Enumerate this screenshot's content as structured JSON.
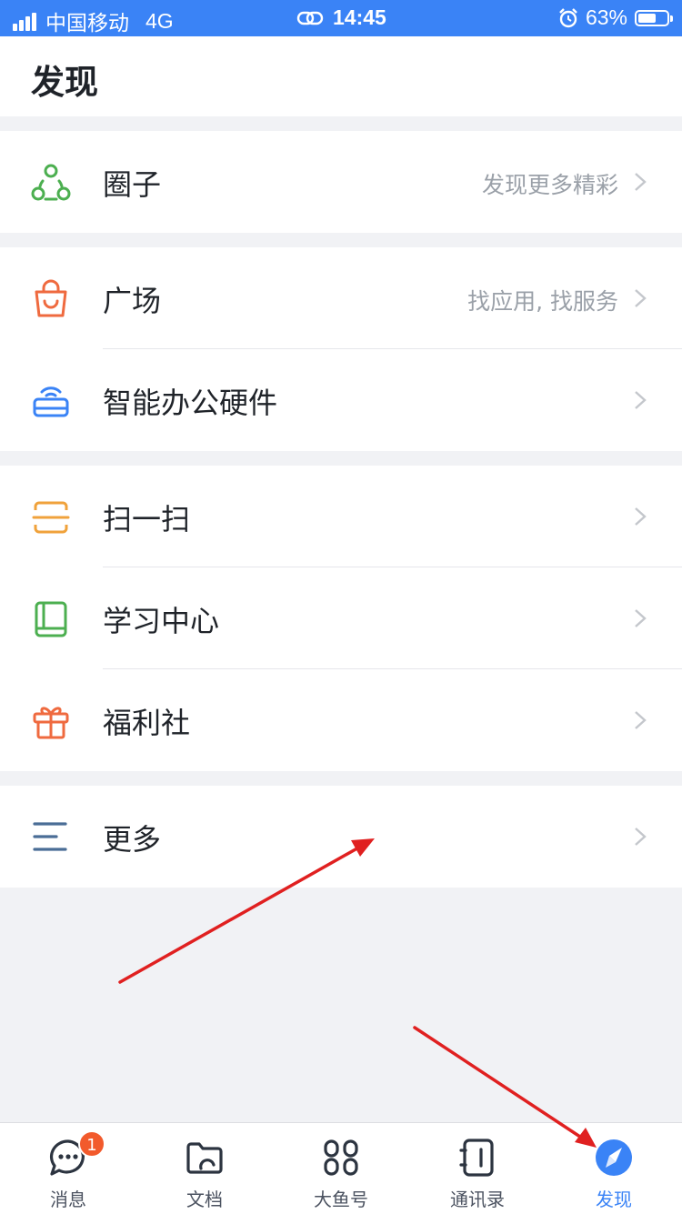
{
  "status_bar": {
    "carrier": "中国移动",
    "network": "4G",
    "time": "14:45",
    "battery_text": "63%",
    "battery_level": 0.63
  },
  "header": {
    "title": "发现"
  },
  "groups": [
    {
      "items": [
        {
          "label": "圈子",
          "subtitle": "发现更多精彩",
          "icon": "circle-group-icon",
          "color": "#4caf50"
        }
      ]
    },
    {
      "items": [
        {
          "label": "广场",
          "subtitle": "找应用, 找服务",
          "icon": "shopping-bag-icon",
          "color": "#ef6a3f"
        },
        {
          "label": "智能办公硬件",
          "subtitle": "",
          "icon": "hardware-device-icon",
          "color": "#3a83f6"
        }
      ]
    },
    {
      "items": [
        {
          "label": "扫一扫",
          "subtitle": "",
          "icon": "scan-icon",
          "color": "#f0a23b"
        },
        {
          "label": "学习中心",
          "subtitle": "",
          "icon": "book-icon",
          "color": "#4caf50"
        },
        {
          "label": "福利社",
          "subtitle": "",
          "icon": "gift-icon",
          "color": "#ef6a3f"
        }
      ]
    },
    {
      "items": [
        {
          "label": "更多",
          "subtitle": "",
          "icon": "more-lines-icon",
          "color": "#4a6d96"
        }
      ]
    }
  ],
  "tabbar": {
    "tabs": [
      {
        "label": "消息",
        "icon": "message-icon",
        "badge": "1"
      },
      {
        "label": "文档",
        "icon": "folder-icon"
      },
      {
        "label": "大鱼号",
        "icon": "apps-grid-icon"
      },
      {
        "label": "通讯录",
        "icon": "contacts-icon"
      },
      {
        "label": "发现",
        "icon": "compass-icon",
        "active": true
      }
    ]
  },
  "colors": {
    "accent": "#3a83f6",
    "badge": "#f25a2c",
    "annotation_arrow": "#e02020"
  }
}
